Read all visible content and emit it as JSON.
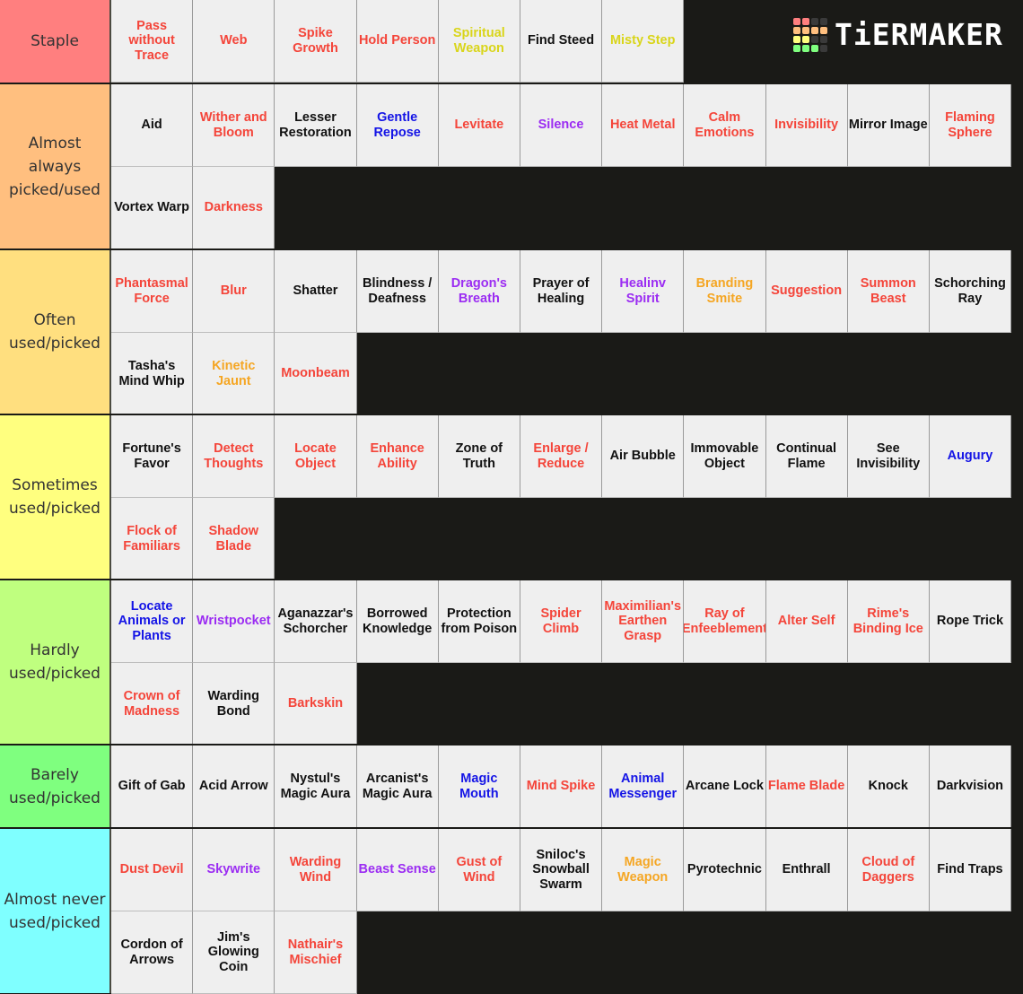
{
  "logo": {
    "text": "TiERMAKER",
    "grid_colors": [
      "#ff7f7f",
      "#ff7f7f",
      "#3a3a3a",
      "#3a3a3a",
      "#ffbf7f",
      "#ffbf7f",
      "#ffbf7f",
      "#ffbf7f",
      "#ffff7f",
      "#ffff7f",
      "#3a3a3a",
      "#3a3a3a",
      "#7fff7f",
      "#7fff7f",
      "#7fff7f",
      "#3a3a3a"
    ]
  },
  "colors": {
    "red": "#f4453a",
    "black": "#111111",
    "blue": "#1414e6",
    "purple": "#9b2cf2",
    "yellow": "#d9d51a",
    "orange": "#f5a623",
    "board_bg": "#1a1a17",
    "cell_bg": "#efefef"
  },
  "tiers": [
    {
      "label": "Staple",
      "color": "#ff7f7f",
      "items": [
        {
          "name": "Pass without Trace",
          "color": "red"
        },
        {
          "name": "Web",
          "color": "red"
        },
        {
          "name": "Spike Growth",
          "color": "red"
        },
        {
          "name": "Hold Person",
          "color": "red"
        },
        {
          "name": "Spiritual Weapon",
          "color": "yellow"
        },
        {
          "name": "Find Steed",
          "color": "black"
        },
        {
          "name": "Misty Step",
          "color": "yellow"
        }
      ]
    },
    {
      "label": "Almost always picked/used",
      "color": "#ffbf7f",
      "items": [
        {
          "name": "Aid",
          "color": "black"
        },
        {
          "name": "Wither and Bloom",
          "color": "red"
        },
        {
          "name": "Lesser Restoration",
          "color": "black"
        },
        {
          "name": "Gentle Repose",
          "color": "blue"
        },
        {
          "name": "Levitate",
          "color": "red"
        },
        {
          "name": "Silence",
          "color": "purple"
        },
        {
          "name": "Heat Metal",
          "color": "red"
        },
        {
          "name": "Calm Emotions",
          "color": "red"
        },
        {
          "name": "Invisibility",
          "color": "red"
        },
        {
          "name": "Mirror Image",
          "color": "black"
        },
        {
          "name": "Flaming Sphere",
          "color": "red"
        },
        {
          "name": "Vortex Warp",
          "color": "black"
        },
        {
          "name": "Darkness",
          "color": "red"
        }
      ]
    },
    {
      "label": "Often used/picked",
      "color": "#ffdf7f",
      "items": [
        {
          "name": "Phantasmal Force",
          "color": "red"
        },
        {
          "name": "Blur",
          "color": "red"
        },
        {
          "name": "Shatter",
          "color": "black"
        },
        {
          "name": "Blindness / Deafness",
          "color": "black"
        },
        {
          "name": "Dragon's Breath",
          "color": "purple"
        },
        {
          "name": "Prayer of Healing",
          "color": "black"
        },
        {
          "name": "Healinv Spirit",
          "color": "purple"
        },
        {
          "name": "Branding Smite",
          "color": "orange"
        },
        {
          "name": "Suggestion",
          "color": "red"
        },
        {
          "name": "Summon Beast",
          "color": "red"
        },
        {
          "name": "Schorching Ray",
          "color": "black"
        },
        {
          "name": "Tasha's Mind Whip",
          "color": "black"
        },
        {
          "name": "Kinetic Jaunt",
          "color": "orange"
        },
        {
          "name": "Moonbeam",
          "color": "red"
        }
      ]
    },
    {
      "label": "Sometimes used/picked",
      "color": "#ffff7f",
      "items": [
        {
          "name": "Fortune's Favor",
          "color": "black"
        },
        {
          "name": "Detect Thoughts",
          "color": "red"
        },
        {
          "name": "Locate Object",
          "color": "red"
        },
        {
          "name": "Enhance Ability",
          "color": "red"
        },
        {
          "name": "Zone of Truth",
          "color": "black"
        },
        {
          "name": "Enlarge / Reduce",
          "color": "red"
        },
        {
          "name": "Air Bubble",
          "color": "black"
        },
        {
          "name": "Immovable Object",
          "color": "black"
        },
        {
          "name": "Continual Flame",
          "color": "black"
        },
        {
          "name": "See Invisibility",
          "color": "black"
        },
        {
          "name": "Augury",
          "color": "blue"
        },
        {
          "name": "Flock of Familiars",
          "color": "red"
        },
        {
          "name": "Shadow Blade",
          "color": "red"
        }
      ]
    },
    {
      "label": "Hardly used/picked",
      "color": "#bfff7f",
      "items": [
        {
          "name": "Locate Animals or Plants",
          "color": "blue"
        },
        {
          "name": "Wristpocket",
          "color": "purple"
        },
        {
          "name": "Aganazzar's Schorcher",
          "color": "black"
        },
        {
          "name": "Borrowed Knowledge",
          "color": "black"
        },
        {
          "name": "Protection from Poison",
          "color": "black"
        },
        {
          "name": "Spider Climb",
          "color": "red"
        },
        {
          "name": "Maximilian's Earthen Grasp",
          "color": "red"
        },
        {
          "name": "Ray of Enfeeblement",
          "color": "red"
        },
        {
          "name": "Alter Self",
          "color": "red"
        },
        {
          "name": "Rime's Binding Ice",
          "color": "red"
        },
        {
          "name": "Rope Trick",
          "color": "black"
        },
        {
          "name": "Crown of Madness",
          "color": "red"
        },
        {
          "name": "Warding Bond",
          "color": "black"
        },
        {
          "name": "Barkskin",
          "color": "red"
        }
      ]
    },
    {
      "label": "Barely used/picked",
      "color": "#7fff7f",
      "items": [
        {
          "name": "Gift of Gab",
          "color": "black"
        },
        {
          "name": "Acid Arrow",
          "color": "black"
        },
        {
          "name": "Nystul's Magic Aura",
          "color": "black"
        },
        {
          "name": "Arcanist's Magic Aura",
          "color": "black"
        },
        {
          "name": "Magic Mouth",
          "color": "blue"
        },
        {
          "name": "Mind Spike",
          "color": "red"
        },
        {
          "name": "Animal Messenger",
          "color": "blue"
        },
        {
          "name": "Arcane Lock",
          "color": "black"
        },
        {
          "name": "Flame Blade",
          "color": "red"
        },
        {
          "name": "Knock",
          "color": "black"
        },
        {
          "name": "Darkvision",
          "color": "black"
        }
      ]
    },
    {
      "label": "Almost never used/picked",
      "color": "#7fffff",
      "items": [
        {
          "name": "Dust Devil",
          "color": "red"
        },
        {
          "name": "Skywrite",
          "color": "purple"
        },
        {
          "name": "Warding Wind",
          "color": "red"
        },
        {
          "name": "Beast Sense",
          "color": "purple"
        },
        {
          "name": "Gust of Wind",
          "color": "red"
        },
        {
          "name": "Sniloc's Snowball Swarm",
          "color": "black"
        },
        {
          "name": "Magic Weapon",
          "color": "orange"
        },
        {
          "name": "Pyrotechnic",
          "color": "black"
        },
        {
          "name": "Enthrall",
          "color": "black"
        },
        {
          "name": "Cloud of Daggers",
          "color": "red"
        },
        {
          "name": "Find Traps",
          "color": "black"
        },
        {
          "name": "Cordon of Arrows",
          "color": "black"
        },
        {
          "name": "Jim's Glowing Coin",
          "color": "black"
        },
        {
          "name": "Nathair's Mischief",
          "color": "red"
        }
      ]
    }
  ]
}
